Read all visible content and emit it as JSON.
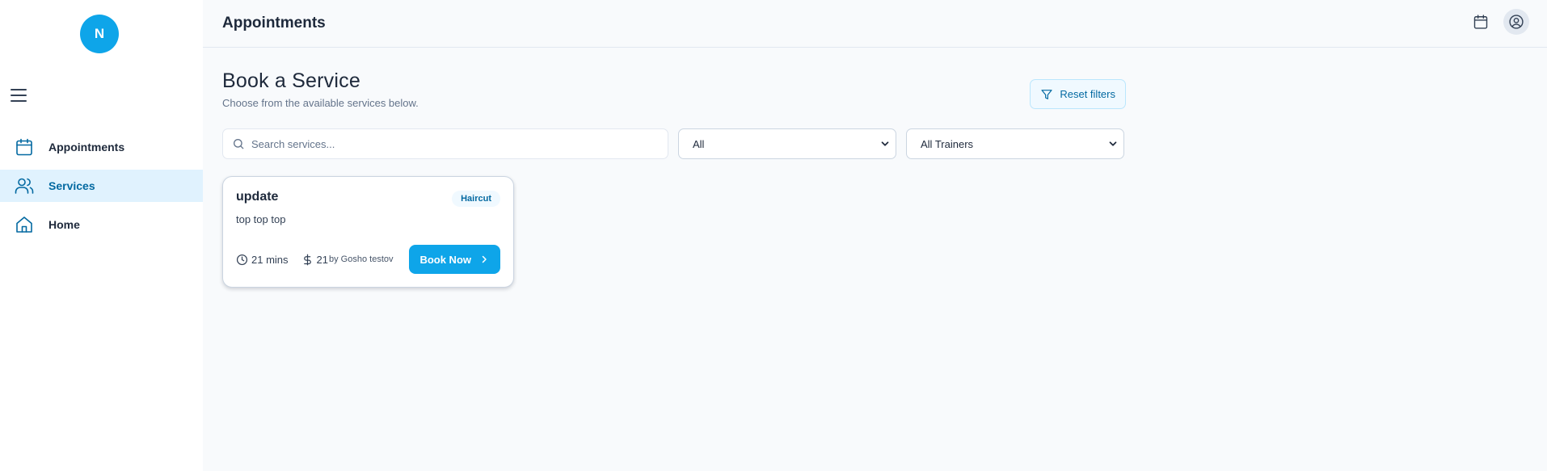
{
  "colors": {
    "accent": "#0ea5e9",
    "accent_dark": "#0369a1",
    "active_nav_bg": "#e0f2fe",
    "text": "#1e293b",
    "muted": "#64748b"
  },
  "sidebar": {
    "avatar_initial": "N",
    "menu_icon": "hamburger-menu-icon",
    "items": [
      {
        "label": "Appointments",
        "icon": "calendar-icon",
        "active": false
      },
      {
        "label": "Services",
        "icon": "users-icon",
        "active": true
      },
      {
        "label": "Home",
        "icon": "home-icon",
        "active": false
      }
    ]
  },
  "header": {
    "title": "Appointments",
    "icons": [
      "calendar-icon",
      "user-circle-icon"
    ]
  },
  "page": {
    "title": "Book a Service",
    "subtitle": "Choose from the available services below.",
    "reset_label": "Reset filters"
  },
  "filters": {
    "search_placeholder": "Search services...",
    "search_value": "",
    "category_selected": "All",
    "trainer_selected": "All Trainers"
  },
  "services": [
    {
      "title": "update",
      "category": "Haircut",
      "description": "top top top",
      "duration": "21 mins",
      "price": "21",
      "by": "by Gosho testov",
      "cta": "Book Now"
    }
  ]
}
